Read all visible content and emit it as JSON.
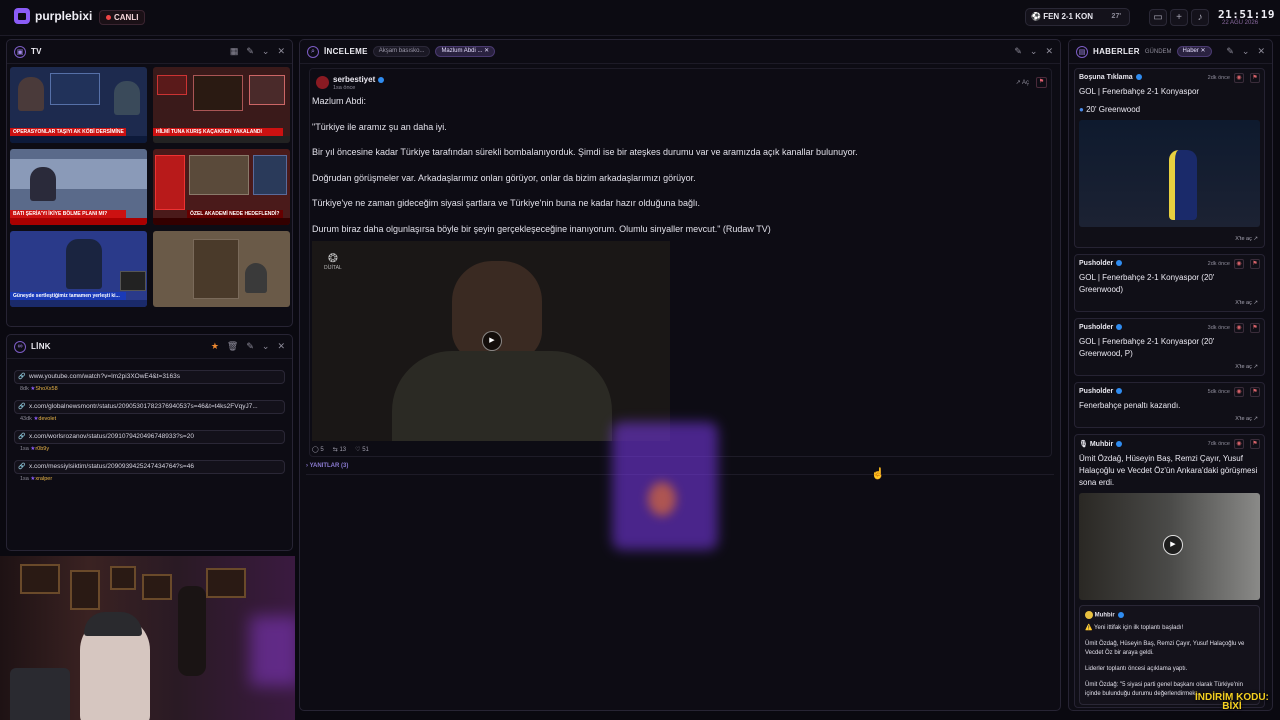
{
  "topbar": {
    "brand": "purplebixi",
    "live_label": "CANLI",
    "match": {
      "home": "FEN",
      "score": "2-1",
      "away": "KON",
      "minute": "27'"
    },
    "clock": "21:51:19",
    "date": "22 AĞU 2026"
  },
  "tv_panel": {
    "title": "TV",
    "tickers": [
      "OPERASYONLAR TAŞIYI AK KÖBİ DERSİMİNE",
      "HİLMİ TUNA KURIŞ KAÇAKKEN YAKALANDI",
      "BATI ŞERİA'YI İKİYE BÖLME PLANI MI?",
      "ÖZEL AKADEMİ NEDE HEDEFLENDİ?",
      "Güneyde sertleştiğimiz tamamen yerleşti ki...",
      ""
    ]
  },
  "link_panel": {
    "title": "LİNK",
    "items": [
      {
        "url": "www.youtube.com/watch?v=lm2pi3XOwE4&t=3163s",
        "time": "8dk",
        "user": "ShoXx58"
      },
      {
        "url": "x.com/globalnewsmontr/status/20905301782376940537s=46&t=t4ks2FVqyJ7...",
        "time": "43dk",
        "user": "devolet"
      },
      {
        "url": "x.com/worlsrozanov/status/2091079420496748933?s=20",
        "time": "1sa",
        "user": "r0b9y"
      },
      {
        "url": "x.com/messiylsiktim/status/2090939425247434764?s=46",
        "time": "1sa",
        "user": "xralper"
      }
    ]
  },
  "inceleme_panel": {
    "title": "İNCELEME",
    "tabs": [
      "Akşam basısko...",
      "Mazlum Abdi ..."
    ],
    "post": {
      "author": "serbestiyet",
      "time": "1sa önce",
      "open_label": "Aç",
      "lines": [
        "Mazlum Abdi:",
        "\"Türkiye ile aramız şu an daha iyi.",
        "Bir yıl öncesine kadar Türkiye tarafından sürekli bombalanıyorduk. Şimdi ise bir ateşkes durumu var ve aramızda açık kanallar bulunuyor.",
        "Doğrudan görüşmeler var. Arkadaşlarımız onları görüyor, onlar da bizim arkadaşlarımızı görüyor.",
        "Türkiye'ye ne zaman gideceğim siyasi şartlara ve Türkiye'nin buna ne kadar hazır olduğuna bağlı.",
        "Durum biraz daha olgunlaşırsa böyle bir şeyin gerçekleşeceğine inanıyorum. Olumlu sinyaller mevcut.\" (Rudaw TV)"
      ],
      "video_logo": "DİJİTAL",
      "stats": {
        "replies": "5",
        "retweets": "13",
        "likes": "51"
      },
      "replies_label": "YANITLAR (3)"
    }
  },
  "news_panel": {
    "title": "HABERLER",
    "tabs": [
      "GÜNDEM",
      "Haber"
    ],
    "items": [
      {
        "source": "Boşuna Tıklama",
        "time": "2dk önce",
        "text": "GOL | Fenerbahçe 2-1 Konyaspor",
        "subtext": "20' Greenwood",
        "link": "X'te aç"
      },
      {
        "source": "Pusholder",
        "time": "2dk önce",
        "text": "GOL | Fenerbahçe 2-1 Konyaspor (20' Greenwood)",
        "link": "X'te aç"
      },
      {
        "source": "Pusholder",
        "time": "3dk önce",
        "text": "GOL | Fenerbahçe 2-1 Konyaspor (20' Greenwood, P)",
        "link": "X'te aç"
      },
      {
        "source": "Pusholder",
        "time": "5dk önce",
        "text": "Fenerbahçe penaltı kazandı.",
        "link": "X'te aç"
      },
      {
        "source": "Muhbir",
        "time": "7dk önce",
        "text": "Ümit Özdağ, Hüseyin Baş, Remzi Çayır, Yusuf Halaçoğlu ve Vecdet Öz'ün Ankara'daki görüşmesi sona erdi."
      }
    ],
    "quote": {
      "source": "Muhbir",
      "lines": [
        "⚠️ Yeni ittifak için ilk toplantı başladı!",
        "Ümit Özdağ, Hüseyin Baş, Remzi Çayır, Yusuf Halaçoğlu ve Vecdet Öz bir araya geldi.",
        "Liderler toplantı öncesi açıklama yaptı.",
        "Ümit Özdağ: \"5 siyasi parti genel başkanı olarak Türkiye'nin içinde bulunduğu durumu değerlendirmek..."
      ]
    }
  },
  "overlay": {
    "line1": "İNDİRİM KODU:",
    "line2": "BİXİ"
  }
}
